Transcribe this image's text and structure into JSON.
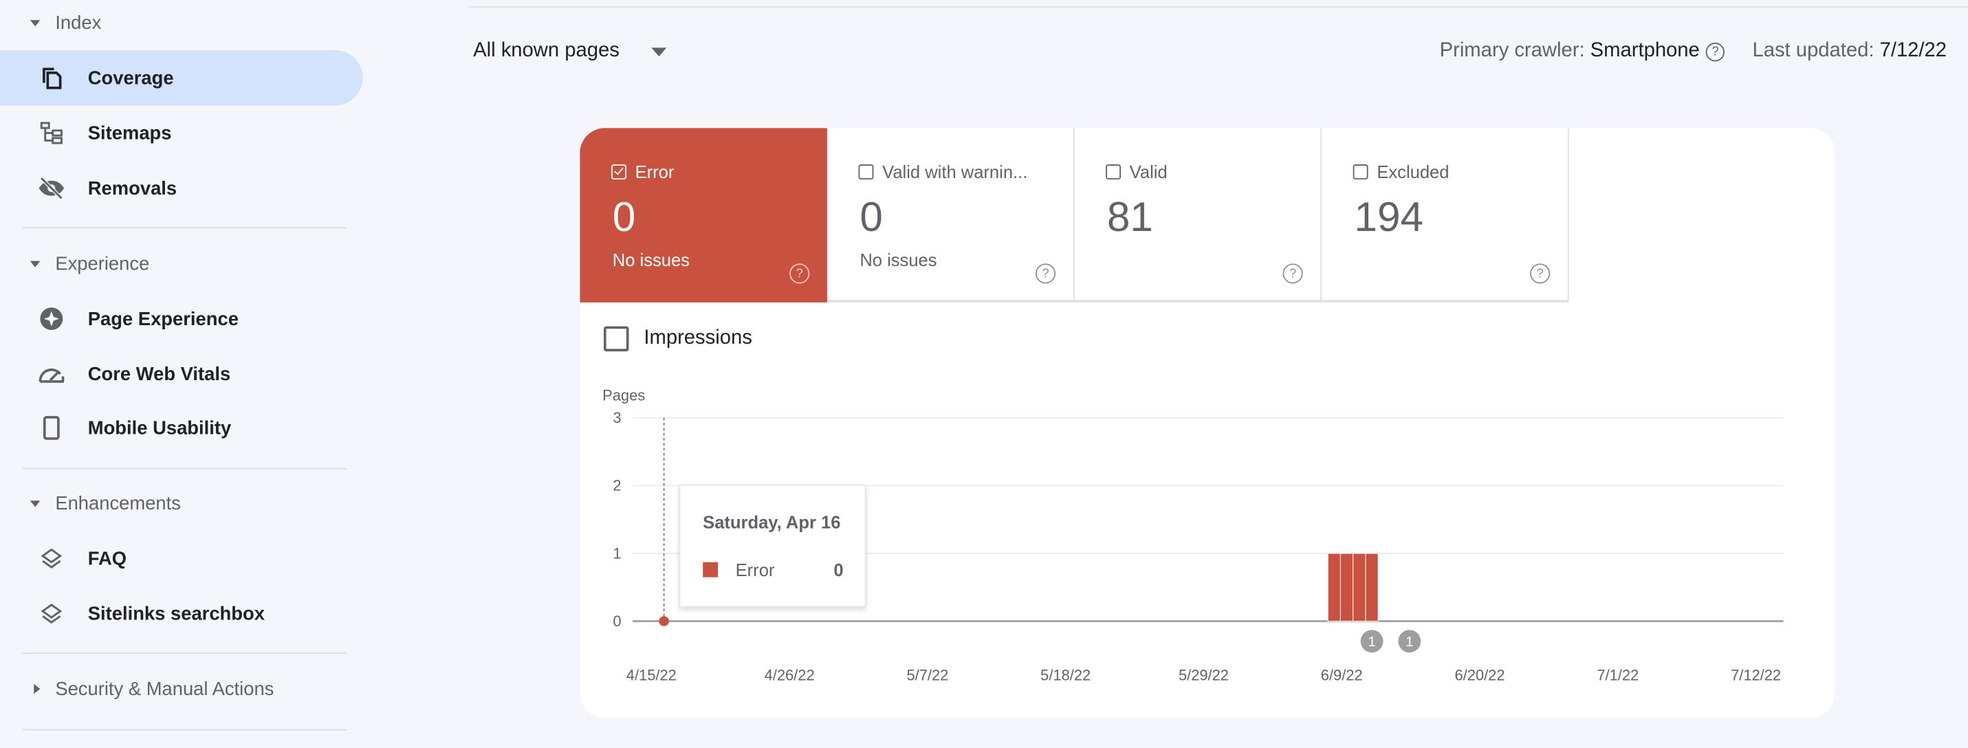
{
  "sidebar": {
    "sections": [
      {
        "label": "Index",
        "expanded": true,
        "items": [
          {
            "label": "Coverage",
            "icon": "coverage-pages-icon",
            "active": true
          },
          {
            "label": "Sitemaps",
            "icon": "sitemap-icon"
          },
          {
            "label": "Removals",
            "icon": "eye-off-icon"
          }
        ]
      },
      {
        "label": "Experience",
        "expanded": true,
        "items": [
          {
            "label": "Page Experience",
            "icon": "sparkle-badge-icon"
          },
          {
            "label": "Core Web Vitals",
            "icon": "speedometer-icon"
          },
          {
            "label": "Mobile Usability",
            "icon": "smartphone-icon"
          }
        ]
      },
      {
        "label": "Enhancements",
        "expanded": true,
        "items": [
          {
            "label": "FAQ",
            "icon": "layers-icon"
          },
          {
            "label": "Sitelinks searchbox",
            "icon": "layers-icon"
          }
        ]
      },
      {
        "label": "Security & Manual Actions",
        "expanded": false,
        "items": []
      }
    ]
  },
  "header": {
    "filter": "All known pages",
    "crawler_label": "Primary crawler:",
    "crawler_value": "Smartphone",
    "updated_label": "Last updated:",
    "updated_value": "7/12/22"
  },
  "tiles": [
    {
      "label": "Error",
      "value": "0",
      "sub": "No issues",
      "checked": true,
      "color": "#c9513f"
    },
    {
      "label": "Valid with warnin...",
      "value": "0",
      "sub": "No issues",
      "checked": false
    },
    {
      "label": "Valid",
      "value": "81",
      "sub": "",
      "checked": false
    },
    {
      "label": "Excluded",
      "value": "194",
      "sub": "",
      "checked": false
    }
  ],
  "impressions": {
    "label": "Impressions",
    "checked": false
  },
  "tooltip": {
    "date": "Saturday, Apr 16",
    "series": "Error",
    "value": "0"
  },
  "chart_data": {
    "type": "bar",
    "ylabel": "Pages",
    "ylim": [
      0,
      3
    ],
    "yticks": [
      "0",
      "1",
      "2",
      "3"
    ],
    "xticks": [
      "4/15/22",
      "4/26/22",
      "5/7/22",
      "5/18/22",
      "5/29/22",
      "6/9/22",
      "6/20/22",
      "7/1/22",
      "7/12/22"
    ],
    "grid": true,
    "series": [
      {
        "name": "Error",
        "color": "#c9513f",
        "points": [
          [
            "4/16/22",
            0
          ],
          [
            "6/7/22",
            0
          ],
          [
            "6/8/22",
            1
          ],
          [
            "6/9/22",
            1
          ],
          [
            "6/10/22",
            1
          ],
          [
            "6/11/22",
            1
          ],
          [
            "6/12/22",
            0
          ],
          [
            "7/12/22",
            0
          ]
        ]
      }
    ],
    "highlighted": "4/16/22",
    "annotations": [
      {
        "date": "6/11/22",
        "label": "1"
      },
      {
        "date": "6/14/22",
        "label": "1"
      }
    ]
  }
}
